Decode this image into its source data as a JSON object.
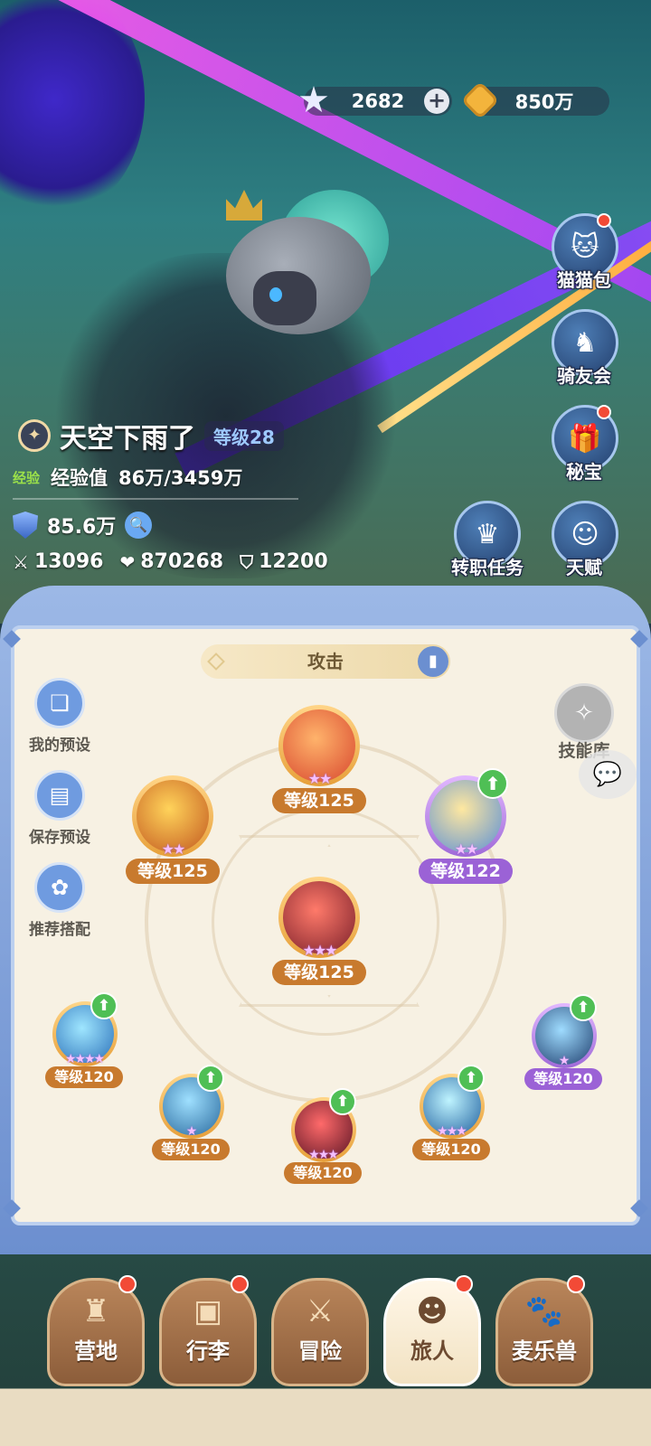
{
  "currency": {
    "gems": "2682",
    "gems_icon": "star-crystal-icon",
    "gold": "850万",
    "gold_icon": "gold-coin-icon",
    "plus": "+"
  },
  "side_menu": [
    {
      "label": "猫猫包",
      "icon": "cat-bag-icon",
      "glyph": "🐱",
      "badge": true
    },
    {
      "label": "骑友会",
      "icon": "horse-icon",
      "glyph": "♞",
      "badge": false
    },
    {
      "label": "秘宝",
      "icon": "treasure-chest-icon",
      "glyph": "🎁",
      "badge": true
    },
    {
      "label": "转职任务",
      "icon": "crown-quest-icon",
      "glyph": "♛",
      "badge": false
    },
    {
      "label": "天赋",
      "icon": "head-brain-icon",
      "glyph": "☺",
      "badge": false
    }
  ],
  "player": {
    "name": "天空下雨了",
    "level": "等级28",
    "exp_tag": "经验",
    "exp_label": "经验值",
    "exp_value": "86万/3459万",
    "power": "85.6万",
    "attack": "13096",
    "hp": "870268",
    "defense": "12200"
  },
  "panel": {
    "tab_title": "攻击",
    "left_buttons": [
      {
        "label": "我的预设",
        "icon": "preset-cards-icon",
        "glyph": "❏"
      },
      {
        "label": "保存预设",
        "icon": "save-disk-icon",
        "glyph": "▤"
      },
      {
        "label": "推荐搭配",
        "icon": "recommend-icon",
        "glyph": "✿"
      }
    ],
    "skill_library": "技能库",
    "skills": [
      {
        "level": "等级125",
        "stars": "★★",
        "color": "orange",
        "upgrade": false,
        "art": [
          "#ffb36b",
          "#d8472e"
        ]
      },
      {
        "level": "等级125",
        "stars": "★★",
        "color": "orange",
        "upgrade": false,
        "art": [
          "#ffd35a",
          "#c2571f"
        ]
      },
      {
        "level": "等级122",
        "stars": "★★",
        "color": "purple",
        "upgrade": true,
        "art": [
          "#ffe8a0",
          "#5a8fd6"
        ]
      },
      {
        "level": "等级125",
        "stars": "★★★",
        "color": "orange",
        "upgrade": false,
        "art": [
          "#ff7a6a",
          "#7a1f2a"
        ]
      },
      {
        "level": "等级120",
        "stars": "★★★★",
        "color": "orange",
        "upgrade": true,
        "art": [
          "#9fe6ff",
          "#2a6fb8"
        ]
      },
      {
        "level": "等级120",
        "stars": "★",
        "color": "orange",
        "upgrade": true,
        "art": [
          "#9fe0ff",
          "#2a6a9e"
        ]
      },
      {
        "level": "等级120",
        "stars": "★★★",
        "color": "orange",
        "upgrade": true,
        "art": [
          "#ff6a6a",
          "#5a1424"
        ]
      },
      {
        "level": "等级120",
        "stars": "★★★",
        "color": "orange",
        "upgrade": true,
        "art": [
          "#bff4ff",
          "#1f5f9e"
        ]
      },
      {
        "level": "等级120",
        "stars": "★",
        "color": "purple",
        "upgrade": true,
        "art": [
          "#9fdcff",
          "#1f3f6e"
        ]
      }
    ],
    "upgrade_glyph": "⬆"
  },
  "nav": [
    {
      "label": "营地",
      "icon": "castle-icon",
      "glyph": "♜",
      "badge": true,
      "active": false
    },
    {
      "label": "行李",
      "icon": "backpack-icon",
      "glyph": "▣",
      "badge": true,
      "active": false
    },
    {
      "label": "冒险",
      "icon": "crossed-swords-icon",
      "glyph": "⚔",
      "badge": false,
      "active": false
    },
    {
      "label": "旅人",
      "icon": "traveler-avatar-icon",
      "glyph": "☻",
      "badge": true,
      "active": true
    },
    {
      "label": "麦乐兽",
      "icon": "cat-face-icon",
      "glyph": "🐾",
      "badge": true,
      "active": false
    }
  ],
  "colors": {
    "panel_bg": "#f7f1e3",
    "level_orange": "#c87a2e",
    "level_purple": "#9b62d6",
    "upgrade_green": "#4fbf55",
    "badge_red": "#f24a36"
  }
}
